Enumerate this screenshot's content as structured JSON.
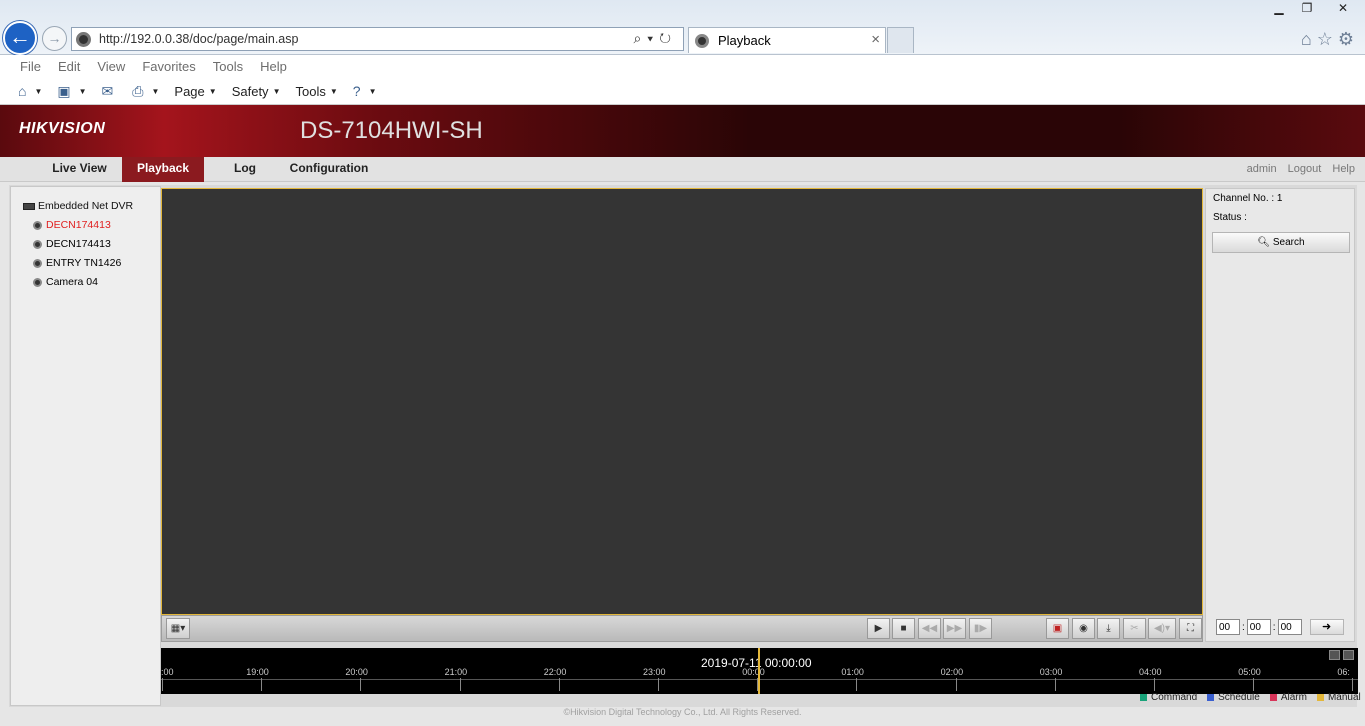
{
  "browser": {
    "url": "http://192.0.0.38/doc/page/main.asp",
    "tab_title": "Playback",
    "menu": [
      "File",
      "Edit",
      "View",
      "Favorites",
      "Tools",
      "Help"
    ],
    "commands": {
      "page": "Page",
      "safety": "Safety",
      "tools": "Tools"
    }
  },
  "header": {
    "brand": "HIKVISION",
    "model": "DS-7104HWI-SH"
  },
  "nav": {
    "tabs": [
      "Live View",
      "Playback",
      "Log",
      "Configuration"
    ],
    "active": "Playback",
    "user": "admin",
    "logout": "Logout",
    "help": "Help"
  },
  "tree": {
    "root": "Embedded Net DVR",
    "cameras": [
      "DECN174413",
      "DECN174413",
      "ENTRY TN1426",
      "Camera 04"
    ],
    "selected_index": 0
  },
  "right_panel": {
    "channel_label": "Channel No. : 1",
    "status_label": "Status :",
    "search_label": "Search",
    "time": {
      "h": "00",
      "m": "00",
      "s": "00"
    }
  },
  "timeline": {
    "datetime": "2019-07-11 00:00:00",
    "ticks": [
      ":00",
      "19:00",
      "20:00",
      "21:00",
      "22:00",
      "23:00",
      "00:00",
      "01:00",
      "02:00",
      "03:00",
      "04:00",
      "05:00",
      "06:"
    ]
  },
  "legend": [
    {
      "label": "Command",
      "color": "#1aa37a"
    },
    {
      "label": "Schedule",
      "color": "#3a5fcf"
    },
    {
      "label": "Alarm",
      "color": "#d8355a"
    },
    {
      "label": "Manual",
      "color": "#e3b73a"
    }
  ],
  "footer": "©Hikvision Digital Technology Co., Ltd. All Rights Reserved.",
  "colors": {
    "active_tab": "#8b1a1f",
    "selected_camera": "#e02020",
    "timeline_cursor": "#e3b73a"
  }
}
